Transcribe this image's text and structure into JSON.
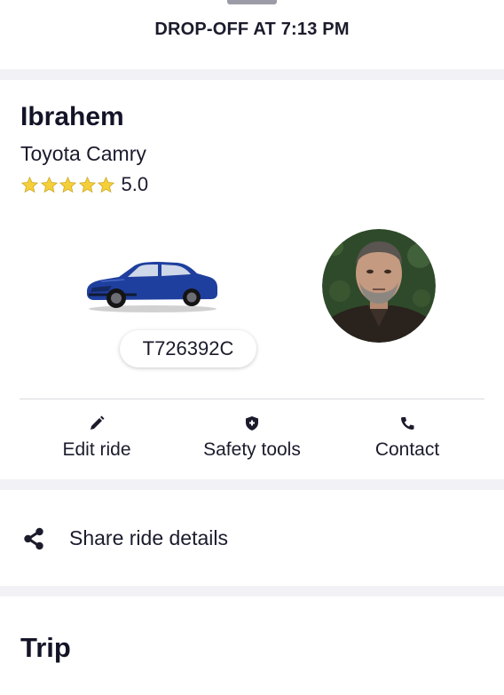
{
  "dropoff": {
    "label": "DROP-OFF AT 7:13 PM"
  },
  "driver": {
    "name": "Ibrahem",
    "car_model": "Toyota Camry",
    "rating": 5.0,
    "rating_text": "5.0",
    "stars_filled": 5,
    "license_plate": "T726392C",
    "car_color": "#1f3f9e"
  },
  "actions": [
    {
      "label": "Edit ride",
      "icon": "pencil-icon"
    },
    {
      "label": "Safety tools",
      "icon": "shield-plus-icon"
    },
    {
      "label": "Contact",
      "icon": "phone-icon"
    }
  ],
  "share": {
    "label": "Share ride details",
    "icon": "share-icon"
  },
  "trip": {
    "title": "Trip"
  },
  "colors": {
    "text": "#1b1b2c",
    "star": "#f5cf3a",
    "background": "#f2f2f6",
    "card": "#ffffff"
  }
}
